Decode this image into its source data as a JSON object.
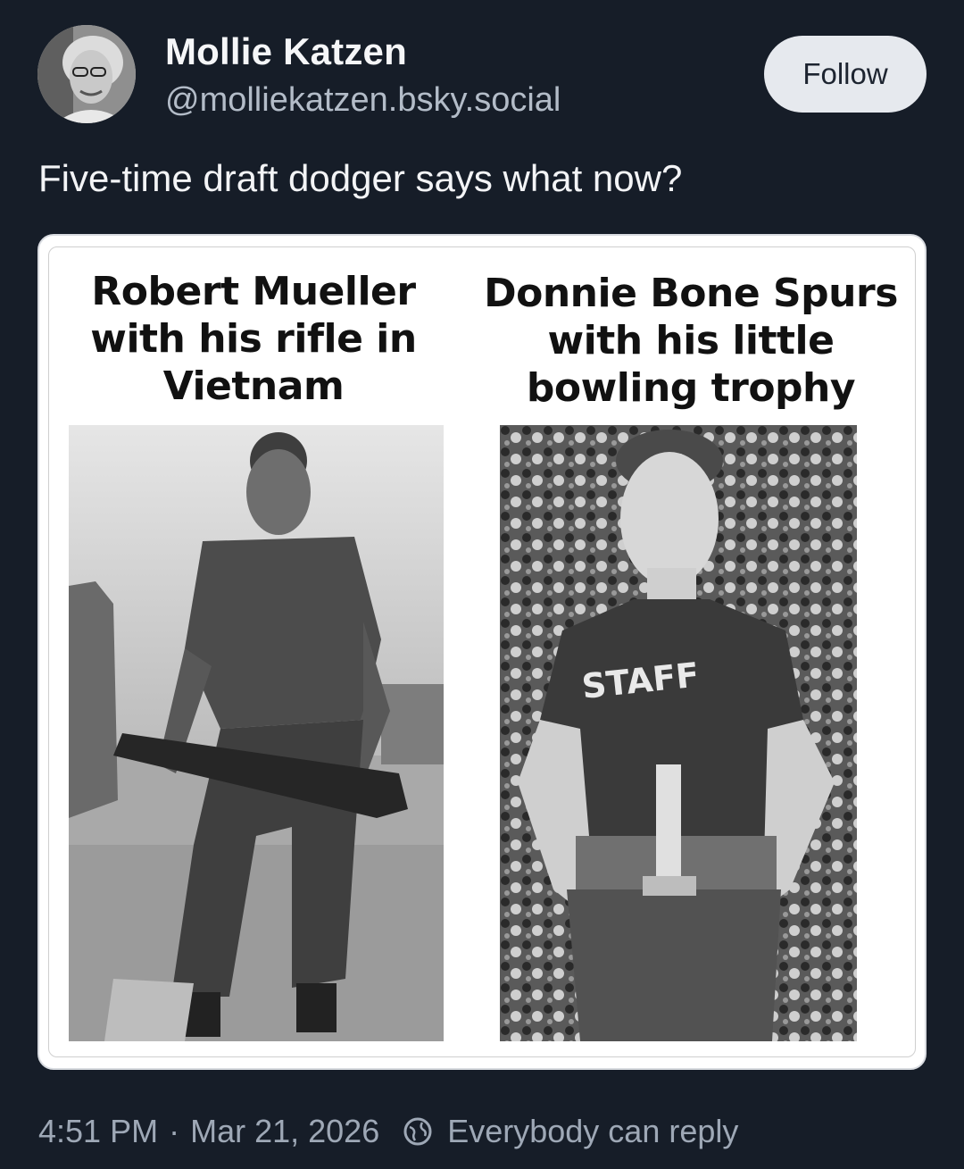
{
  "post": {
    "author_name": "Mollie Katzen",
    "author_handle": "@molliekatzen.bsky.social",
    "follow_label": "Follow",
    "text": "Five-time draft dodger says what now?",
    "time": "4:51 PM",
    "separator": "·",
    "date": "Mar 21, 2026",
    "reply_setting": "Everybody can reply",
    "reply_icon": "globe-icon"
  },
  "image": {
    "left_caption_lines": [
      "Robert Mueller",
      "with his rifle in",
      "Vietnam"
    ],
    "right_caption_lines": [
      "Donnie Bone Spurs",
      "with his little",
      "bowling trophy"
    ],
    "shirt_text": "STAFF"
  },
  "colors": {
    "background": "#161d28",
    "follow_bg": "#e6e9ee",
    "muted_text": "#9ea8b6"
  }
}
